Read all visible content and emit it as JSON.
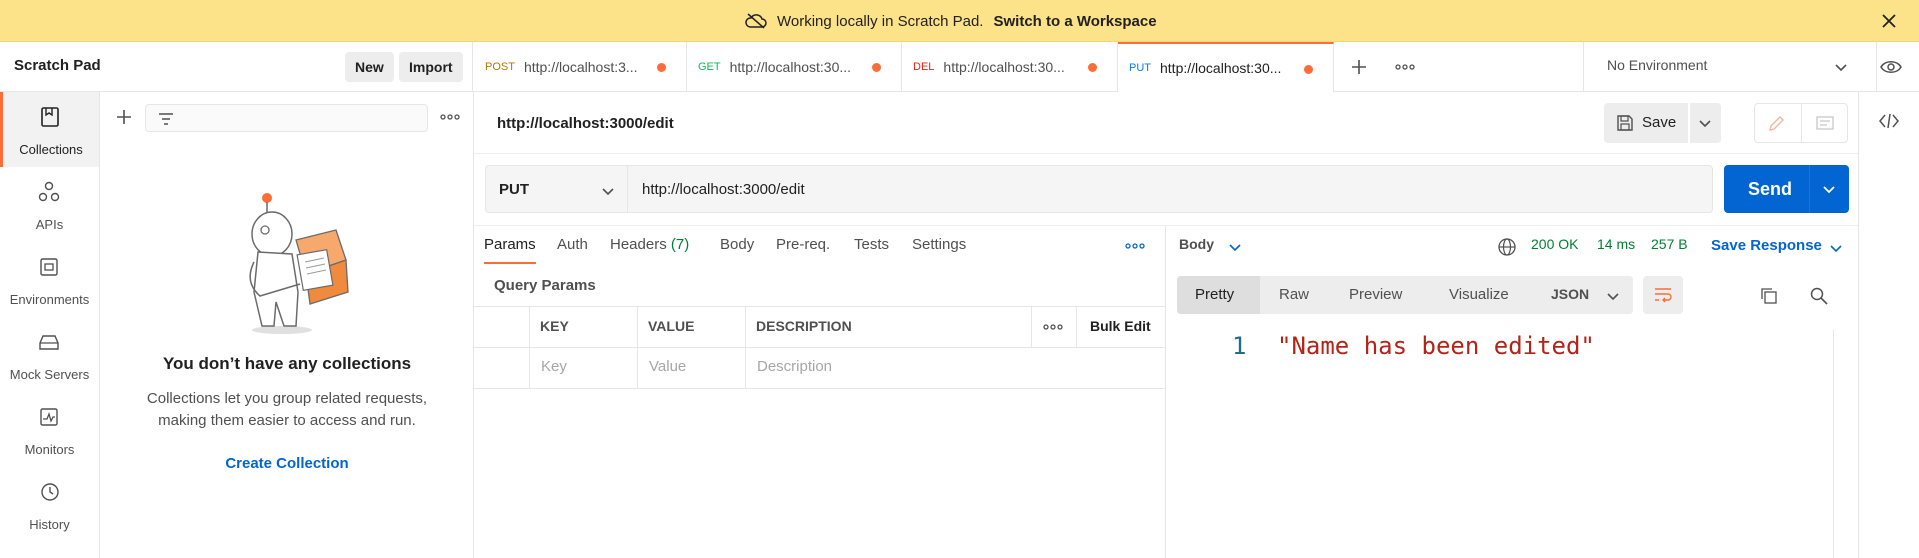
{
  "banner": {
    "text": "Working locally in Scratch Pad.",
    "link": "Switch to a Workspace"
  },
  "workspace": {
    "title": "Scratch Pad",
    "new_label": "New",
    "import_label": "Import"
  },
  "tabs": [
    {
      "method": "POST",
      "url": "http://localhost:3..."
    },
    {
      "method": "GET",
      "url": "http://localhost:30..."
    },
    {
      "method": "DEL",
      "url": "http://localhost:30..."
    },
    {
      "method": "PUT",
      "url": "http://localhost:30..."
    }
  ],
  "environment": "No Environment",
  "sidebar": {
    "items": [
      {
        "label": "Collections",
        "icon": "collections-icon"
      },
      {
        "label": "APIs",
        "icon": "apis-icon"
      },
      {
        "label": "Environments",
        "icon": "environments-icon"
      },
      {
        "label": "Mock Servers",
        "icon": "mock-servers-icon"
      },
      {
        "label": "Monitors",
        "icon": "monitors-icon"
      },
      {
        "label": "History",
        "icon": "history-icon"
      }
    ]
  },
  "collections_panel": {
    "empty_title": "You don’t have any collections",
    "empty_desc": "Collections let you group related requests, making them easier to access and run.",
    "create_label": "Create Collection"
  },
  "request": {
    "title": "http://localhost:3000/edit",
    "save_label": "Save",
    "method": "PUT",
    "url": "http://localhost:3000/edit",
    "send_label": "Send",
    "tabs": [
      "Params",
      "Auth",
      "Headers",
      "Body",
      "Pre-req.",
      "Tests",
      "Settings"
    ],
    "headers_count": "(7)",
    "query_params_title": "Query Params",
    "columns": [
      "KEY",
      "VALUE",
      "DESCRIPTION"
    ],
    "bulk_edit": "Bulk Edit",
    "placeholders": {
      "key": "Key",
      "value": "Value",
      "description": "Description"
    }
  },
  "response": {
    "label": "Body",
    "status": "200 OK",
    "time": "14 ms",
    "size": "257 B",
    "save_label": "Save Response",
    "view_tabs": [
      "Pretty",
      "Raw",
      "Preview",
      "Visualize"
    ],
    "format": "JSON",
    "line_number": "1",
    "body": "\"Name has been edited\""
  },
  "colors": {
    "accent": "#ff6c37",
    "primary": "#0265d2",
    "banner": "#fce38a"
  }
}
